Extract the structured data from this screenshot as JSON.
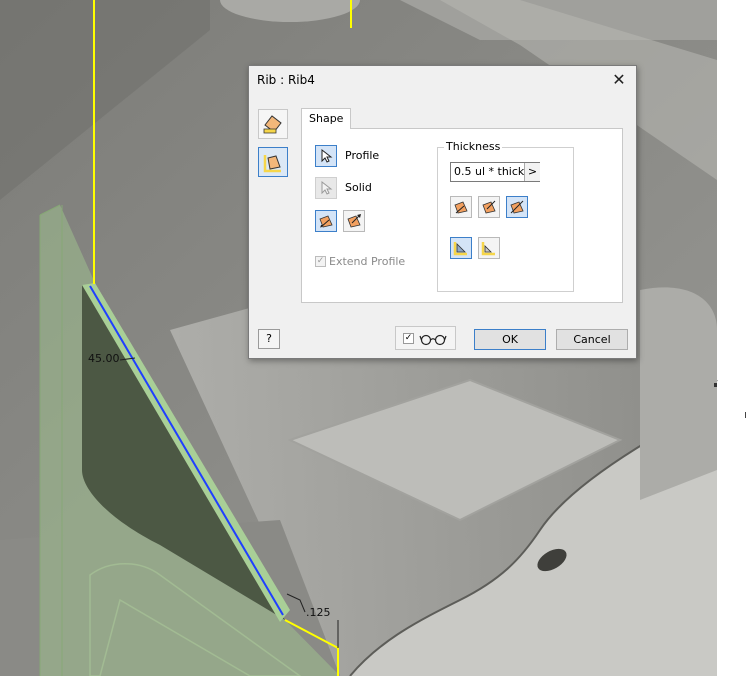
{
  "viewport": {
    "dimension_angle": "45.00",
    "dimension_thickness": ".125"
  },
  "dialog": {
    "title": "Rib : Rib4",
    "close_icon": "close-x-icon",
    "side_buttons": [
      {
        "icon": "rib-normal-to-sketch-icon",
        "active": false
      },
      {
        "icon": "rib-parallel-to-sketch-icon",
        "active": true
      }
    ],
    "tabs": [
      {
        "label": "Shape"
      }
    ],
    "shape": {
      "profile_label": "Profile",
      "solid_label": "Solid",
      "extend_profile_label": "Extend Profile",
      "extend_profile_checked": true,
      "extend_profile_enabled": false
    },
    "thickness": {
      "group_label": "Thickness",
      "value": "0.5 ul * thickn",
      "arrow": ">"
    },
    "footer": {
      "help_label": "?",
      "preview_checked": true,
      "ok_label": "OK",
      "cancel_label": "Cancel"
    }
  },
  "colors": {
    "viewport_bg": "#8e8e8a",
    "rib_fill": "#9fbf8e",
    "profile_line": "#1f3fff",
    "sketch_line": "#ffff00",
    "accent": "#3c7fc9"
  }
}
